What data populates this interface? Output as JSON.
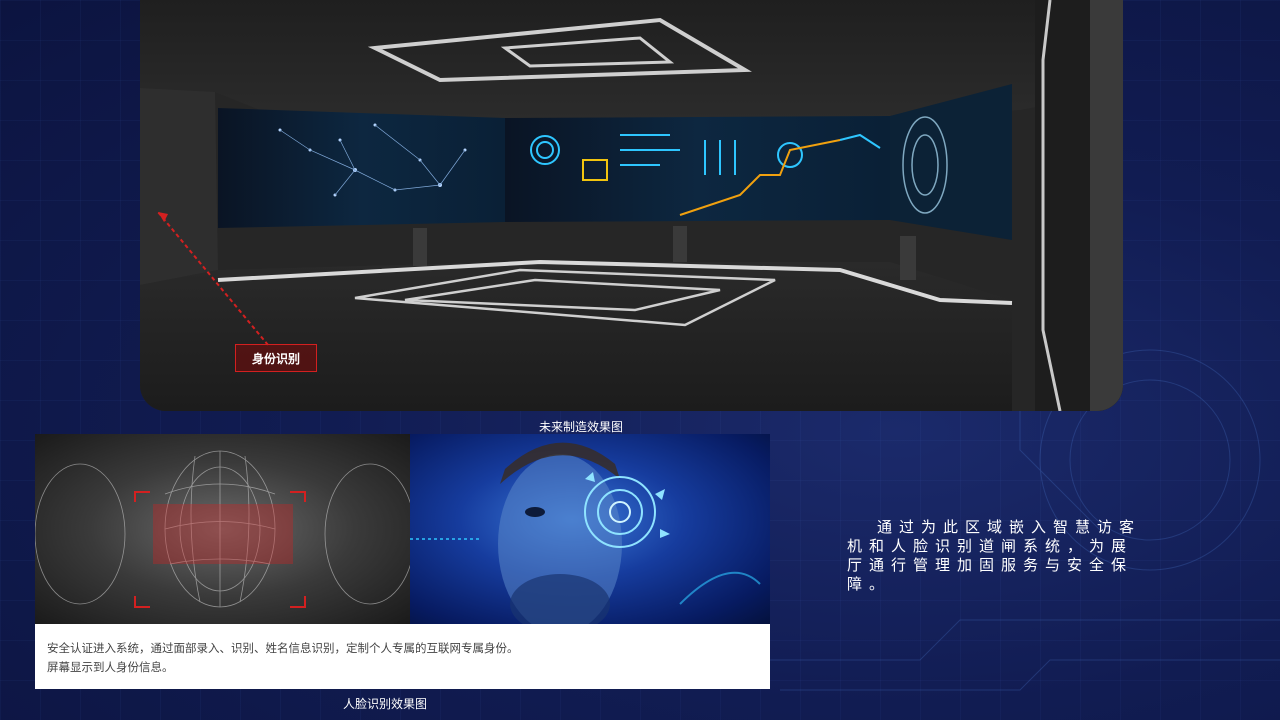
{
  "render": {
    "tag_label": "身份识别",
    "caption": "未来制造效果图"
  },
  "face": {
    "description_line1": "安全认证进入系统，通过面部录入、识别、姓名信息识别，定制个人专属的互联网专属身份。",
    "description_line2": "屏幕显示到人身份信息。",
    "caption": "人脸识别效果图"
  },
  "side_text": "通过为此区域嵌入智慧访客机和人脸识别道闸系统，为展厅通行管理加固服务与安全保障。",
  "colors": {
    "background": "#111c52",
    "accent_red": "#d32020",
    "screen_cyan": "#2ec6ff",
    "screen_yellow": "#f1c40f"
  }
}
